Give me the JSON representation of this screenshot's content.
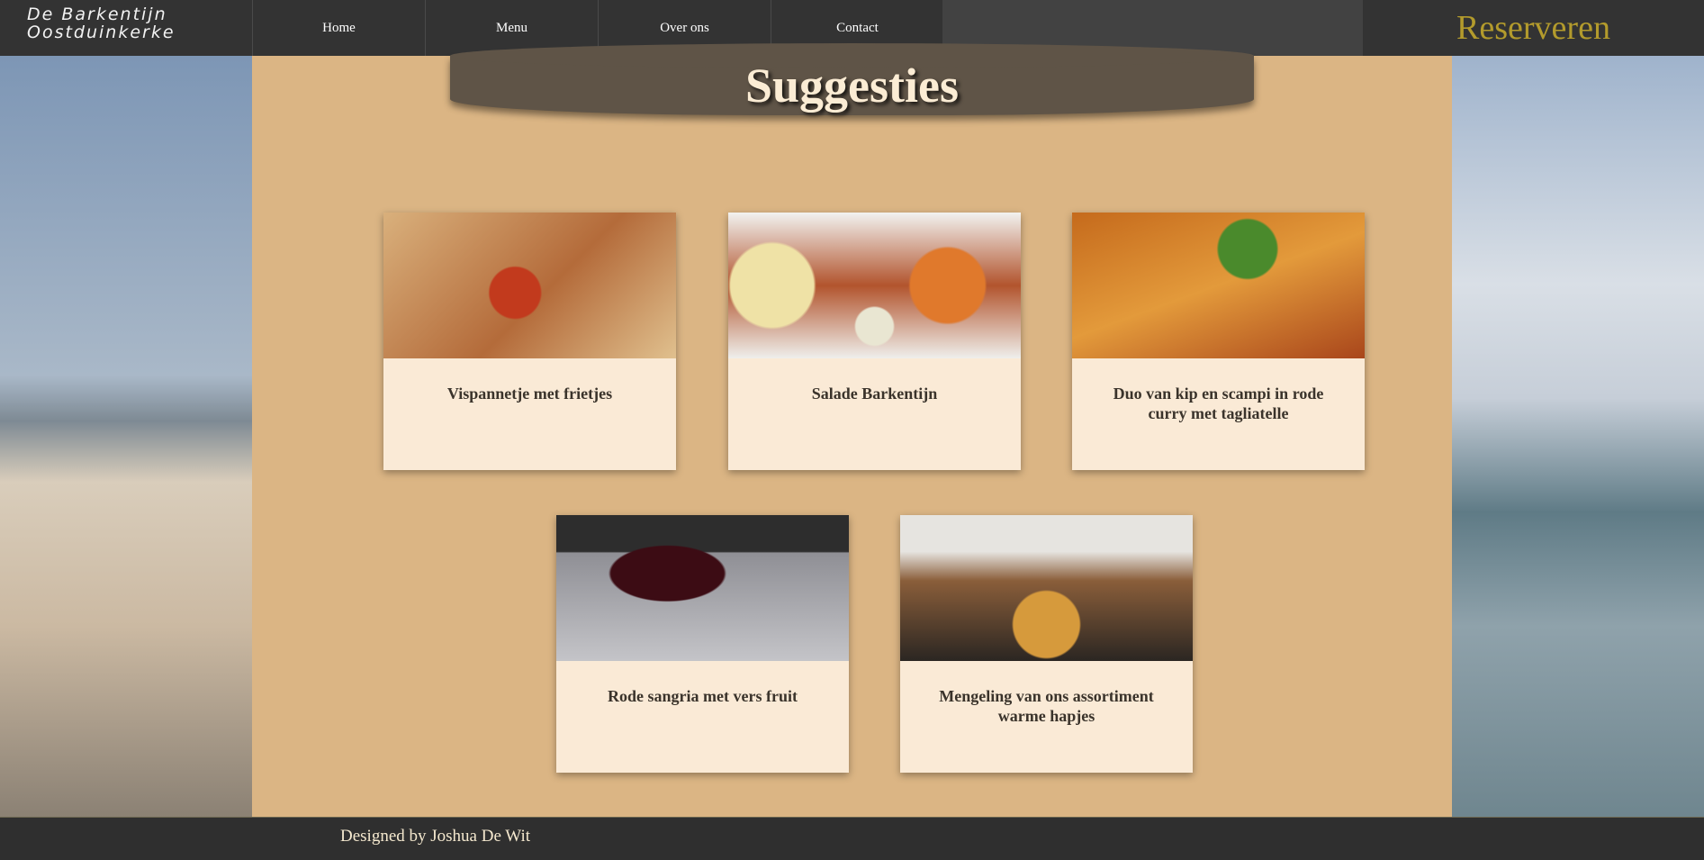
{
  "brand": {
    "line1": "De Barkentijn",
    "line2": "Oostduinkerke"
  },
  "nav": {
    "items": [
      {
        "label": "Home"
      },
      {
        "label": "Menu"
      },
      {
        "label": "Over ons"
      },
      {
        "label": "Contact"
      }
    ],
    "reserve_label": "Reserveren"
  },
  "main": {
    "title": "Suggesties",
    "cards": [
      {
        "title": "Vispannetje met frietjes"
      },
      {
        "title": "Salade Barkentijn"
      },
      {
        "title": "Duo van kip en scampi in rode curry met tagliatelle"
      },
      {
        "title": "Rode sangria met vers fruit"
      },
      {
        "title": "Mengeling van ons assortiment warme hapjes"
      }
    ]
  },
  "footer": {
    "credit": "Designed by Joshua De Wit"
  },
  "colors": {
    "nav_bg": "#333333",
    "accent_gold": "#b39b2c",
    "content_bg": "#dbb584",
    "card_bg": "#faead6",
    "banner_bg": "#5f5447"
  }
}
